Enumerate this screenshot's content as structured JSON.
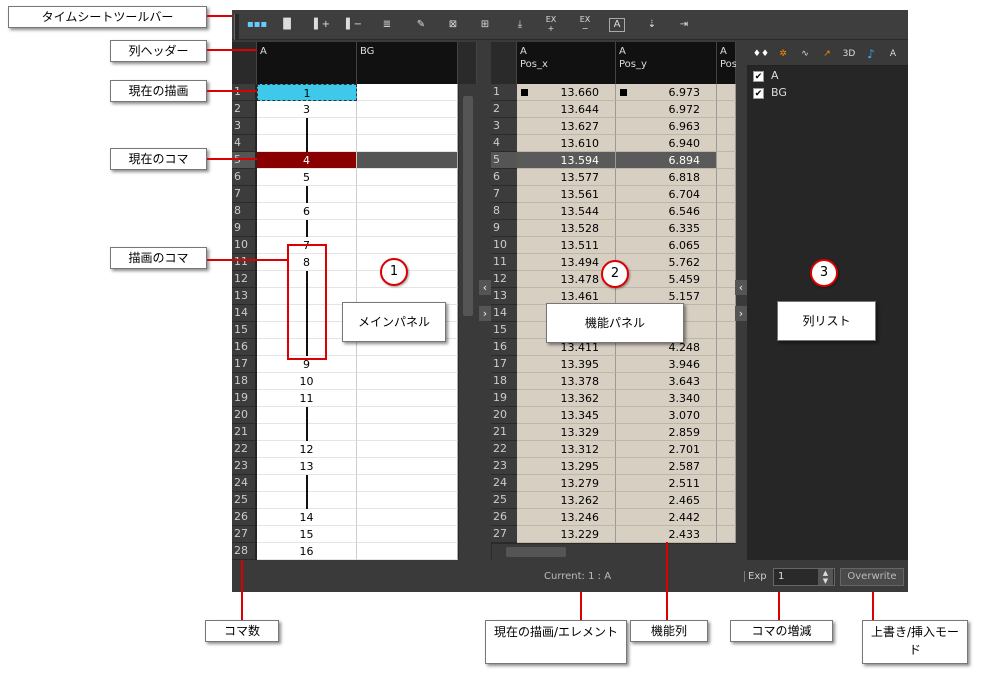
{
  "toolbar": {
    "icons": [
      "dots-icon",
      "column-view-icon",
      "add-column-icon",
      "remove-column-icon",
      "sequence-fill-icon",
      "draw-icon",
      "clear-icon",
      "import-icon",
      "insert-keyframe-icon",
      "extend-exposure-icon",
      "reduce-exposure-icon",
      "drawing-substitution-icon",
      "hold-icon",
      "export-icon"
    ],
    "ex_plus": "EX\n+",
    "ex_minus": "EX\n−"
  },
  "main_panel": {
    "columns": [
      {
        "name": "A"
      },
      {
        "name": "BG"
      }
    ],
    "rows": [
      "1",
      "2",
      "3",
      "4",
      "5",
      "6",
      "7",
      "8",
      "9",
      "10",
      "11",
      "12",
      "13",
      "14",
      "15",
      "16",
      "17",
      "18",
      "19",
      "20",
      "21",
      "22",
      "23",
      "24",
      "25",
      "26",
      "27",
      "28"
    ],
    "a_values": [
      "1",
      "3",
      "",
      "",
      "4",
      "5",
      "",
      "6",
      "",
      "7",
      "8",
      "",
      "",
      "",
      "",
      "",
      "9",
      "10",
      "11",
      "",
      "",
      "12",
      "13",
      "",
      "",
      "14",
      "15",
      "16"
    ],
    "current_drawing_row": 1,
    "current_frame_row": 5
  },
  "function_panel": {
    "columns": [
      {
        "element": "A",
        "name": "Pos_x"
      },
      {
        "element": "A",
        "name": "Pos_y"
      },
      {
        "element": "A",
        "name": "Pos"
      }
    ],
    "pos_x": [
      "13.660",
      "13.644",
      "13.627",
      "13.610",
      "13.594",
      "13.577",
      "13.561",
      "13.544",
      "13.528",
      "13.511",
      "13.494",
      "13.478",
      "13.461",
      "",
      "",
      "13.411",
      "13.395",
      "13.378",
      "13.362",
      "13.345",
      "13.329",
      "13.312",
      "13.295",
      "13.279",
      "13.262",
      "13.246",
      "13.229"
    ],
    "pos_y": [
      "6.973",
      "6.972",
      "6.963",
      "6.940",
      "6.894",
      "6.818",
      "6.704",
      "6.546",
      "6.335",
      "6.065",
      "5.762",
      "5.459",
      "5.157",
      "",
      "",
      "4.248",
      "3.946",
      "3.643",
      "3.340",
      "3.070",
      "2.859",
      "2.701",
      "2.587",
      "2.511",
      "2.465",
      "2.442",
      "2.433"
    ]
  },
  "column_list": {
    "tabs": [
      "keys-icon",
      "colors-icon",
      "curve-icon",
      "pen-icon",
      "3D",
      "note-icon",
      "A"
    ],
    "items": [
      {
        "label": "A",
        "checked": true
      },
      {
        "label": "BG",
        "checked": true
      }
    ]
  },
  "status_bar": {
    "current": "Current: 1 : A",
    "exp_label": "Exp",
    "exp_value": "1",
    "mode": "Overwrite"
  },
  "callouts": {
    "timesheet_toolbar": "タイムシートツールバー",
    "column_header": "列ヘッダー",
    "current_drawing": "現在の描画",
    "current_frame": "現在のコマ",
    "drawing_frames": "描画のコマ",
    "main_panel": "メインパネル",
    "function_panel": "機能パネル",
    "column_list": "列リスト",
    "frame_count": "コマ数",
    "current_drawing_element": "現在の描画/エレメント",
    "function_column": "機能列",
    "frame_increment": "コマの増減",
    "overwrite_insert": "上書き/挿入モード"
  },
  "numbers": {
    "one": "1",
    "two": "2",
    "three": "3"
  }
}
